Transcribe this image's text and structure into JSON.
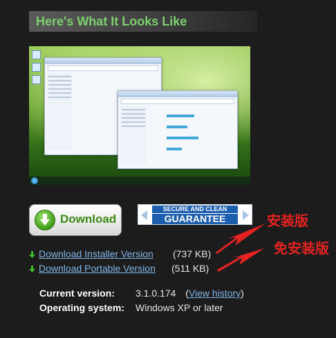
{
  "section": {
    "heading": "Here's What It Looks Like"
  },
  "screenshot": {
    "alt_icon": "windows-desktop-preview"
  },
  "download_button": {
    "label": "Download",
    "icon": "green-down-arrow-icon"
  },
  "guarantee_badge": {
    "line1": "SECURE AND CLEAN",
    "line2": "GUARANTEE"
  },
  "annotations": {
    "installer": "安装版",
    "portable": "免安装版",
    "color": "#e62222"
  },
  "links": [
    {
      "label": "Download Installer Version",
      "size": "(737 KB)"
    },
    {
      "label": "Download Portable Version",
      "size": "(511 KB)"
    }
  ],
  "info": {
    "current_version_label": "Current version:",
    "current_version_value": "3.1.0.174",
    "paren_open": "(",
    "view_history": "View history",
    "paren_close": ")",
    "os_label": "Operating system:",
    "os_value": "Windows XP or later"
  },
  "colors": {
    "heading": "#7ed06e",
    "link": "#7fb6e8",
    "background": "#1c1c1c"
  }
}
